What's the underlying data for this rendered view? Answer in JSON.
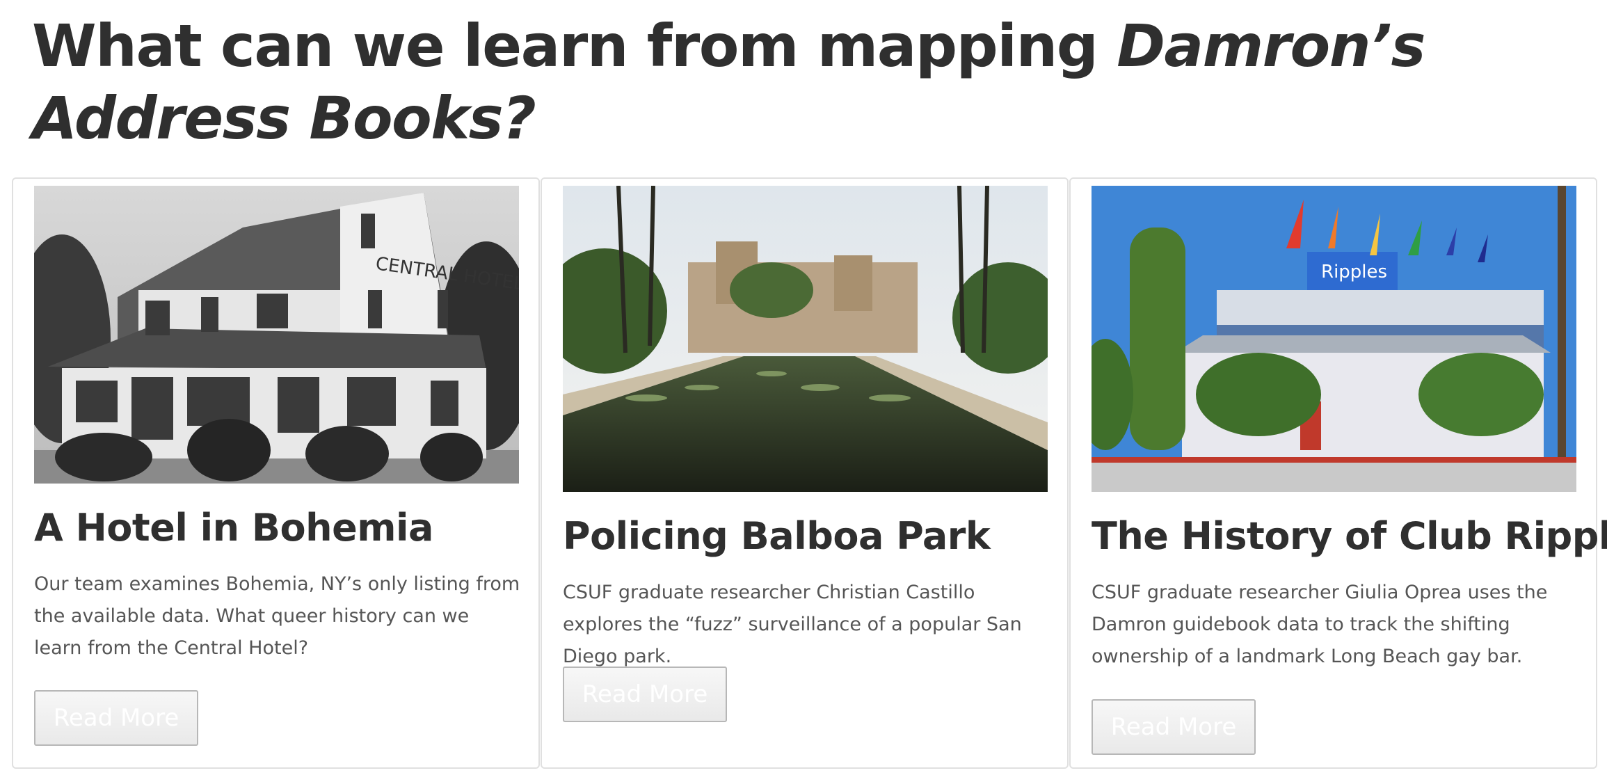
{
  "header": {
    "title_plain": "What can we learn from mapping ",
    "title_italic": "Damron’s Address Books?"
  },
  "cards": [
    {
      "image_alt": "Black and white photo of the Central Hotel",
      "image_sign": "CENTRAL HOTEL",
      "title": "A Hotel in Bohemia",
      "description": "Our team examines Bohemia, NY’s only listing from the available data. What queer history can we learn from the Central Hotel?",
      "button_label": "Read More"
    },
    {
      "image_alt": "Reflecting pool in Balboa Park",
      "title": "Policing Balboa Park",
      "description": "CSUF graduate researcher Christian Castillo explores the “fuzz” surveillance of a popular San Diego park.",
      "button_label": "Read More"
    },
    {
      "image_alt": "Club Ripples building with colorful flags",
      "image_sign": "Ripples",
      "title": "The History of Club Ripples",
      "description": "CSUF graduate researcher Giulia Oprea uses the Damron guidebook data to track the shifting ownership of a landmark Long Beach gay bar.",
      "button_label": "Read More"
    }
  ],
  "colors": {
    "button_text": "#ffffff",
    "title": "#2f2f2f",
    "body_text": "#555555"
  }
}
